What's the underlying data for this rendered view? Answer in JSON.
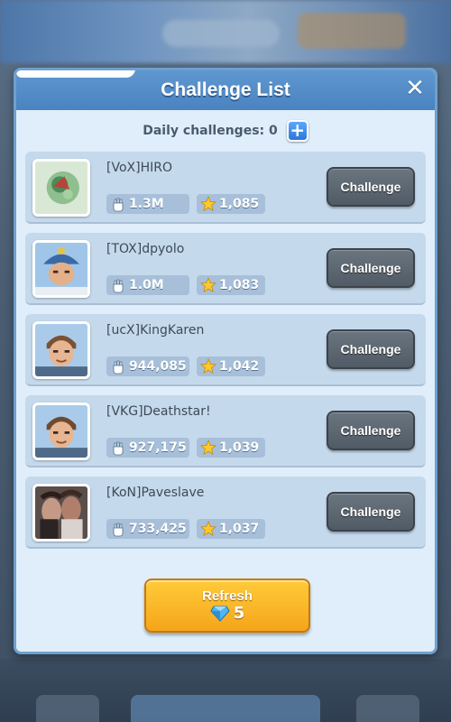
{
  "dialog": {
    "title": "Challenge List",
    "close_icon": "close-icon",
    "daily_label": "Daily challenges: 0",
    "add_icon": "plus-icon"
  },
  "players": [
    {
      "name": "[VoX]HIRO",
      "power": "1.3M",
      "trophies": "1,085",
      "avatar": "green-flower"
    },
    {
      "name": "[TOX]dpyolo",
      "power": "1.0M",
      "trophies": "1,083",
      "avatar": "king-helmet"
    },
    {
      "name": "[ucX]KingKaren",
      "power": "944,085",
      "trophies": "1,042",
      "avatar": "soldier"
    },
    {
      "name": "[VKG]Deathstar!",
      "power": "927,175",
      "trophies": "1,039",
      "avatar": "soldier"
    },
    {
      "name": "[KoN]Paveslave",
      "power": "733,425",
      "trophies": "1,037",
      "avatar": "photo"
    }
  ],
  "challenge_label": "Challenge",
  "refresh": {
    "label": "Refresh",
    "cost": "5",
    "cost_icon": "gem-icon"
  },
  "colors": {
    "dialog_bg": "#dfeefa",
    "header_bg": "#4a83c0",
    "row_bg": "#c5d9ec",
    "challenge_btn": "#505b66",
    "refresh_btn": "#f5a51a"
  }
}
